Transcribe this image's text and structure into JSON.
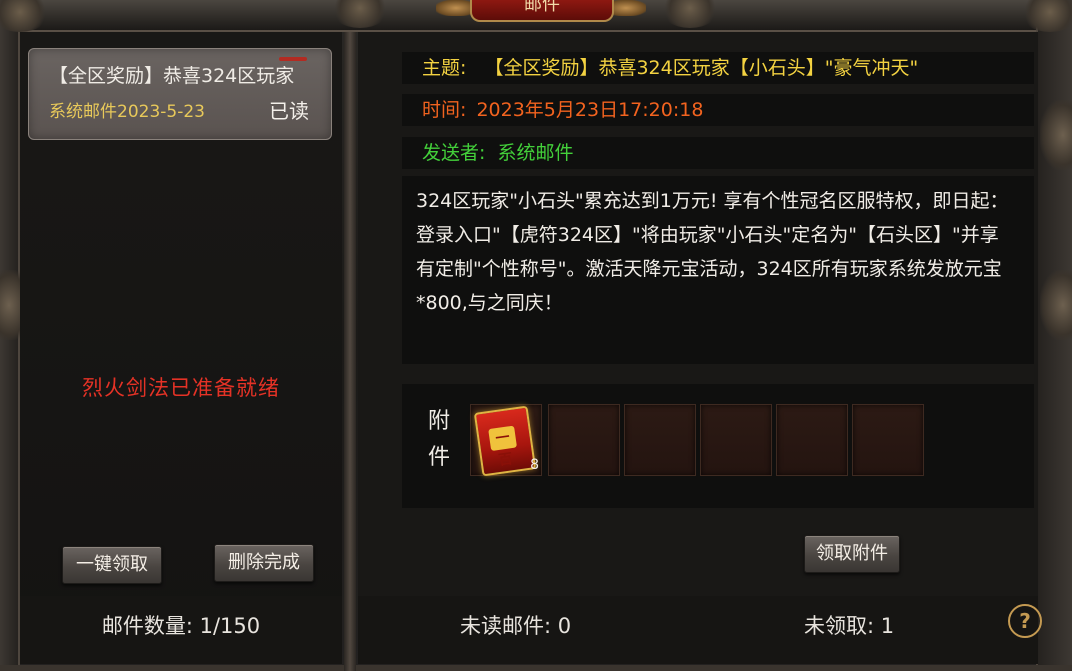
{
  "window": {
    "title": "邮件"
  },
  "mail_list": {
    "items": [
      {
        "title": "【全区奖励】恭喜324区玩家",
        "sender_date": "系统邮件2023-5-23",
        "status": "已读"
      }
    ]
  },
  "notice": {
    "text": "烈火剑法已准备就绪"
  },
  "left_buttons": {
    "claim_all": "一键领取",
    "delete_done": "删除完成"
  },
  "left_footer": {
    "mail_count_label": "邮件数量: ",
    "mail_count_value": "1/150"
  },
  "detail": {
    "subject_label": "主题:",
    "subject_value": "【全区奖励】恭喜324区玩家【小石头】\"豪气冲天\"",
    "time_label": "时间:",
    "time_value": "2023年5月23日17:20:18",
    "sender_label": "发送者:",
    "sender_value": "系统邮件",
    "body": "324区玩家\"小石头\"累充达到1万元! 享有个性冠名区服特权，即日起：登录入口\"【虎符324区】\"将由玩家\"小石头\"定名为\"【石头区】\"并享有定制\"个性称号\"。激活天降元宝活动，324区所有玩家系统发放元宝*800,与之同庆！"
  },
  "attachments": {
    "label": "附件",
    "items": [
      {
        "icon": "red-treasure-scroll-icon",
        "glyph": "一百",
        "count": "8"
      }
    ],
    "empty_slots": 5,
    "claim_button": "领取附件"
  },
  "right_footer": {
    "unread_label": "未读邮件: ",
    "unread_value": "0",
    "unclaimed_label": "未领取: ",
    "unclaimed_value": "1",
    "help_glyph": "?"
  },
  "colors": {
    "subject": "#f3d241",
    "time": "#f2631f",
    "sender": "#43d03a",
    "notice": "#e53226",
    "mail_date": "#e8c95a"
  }
}
